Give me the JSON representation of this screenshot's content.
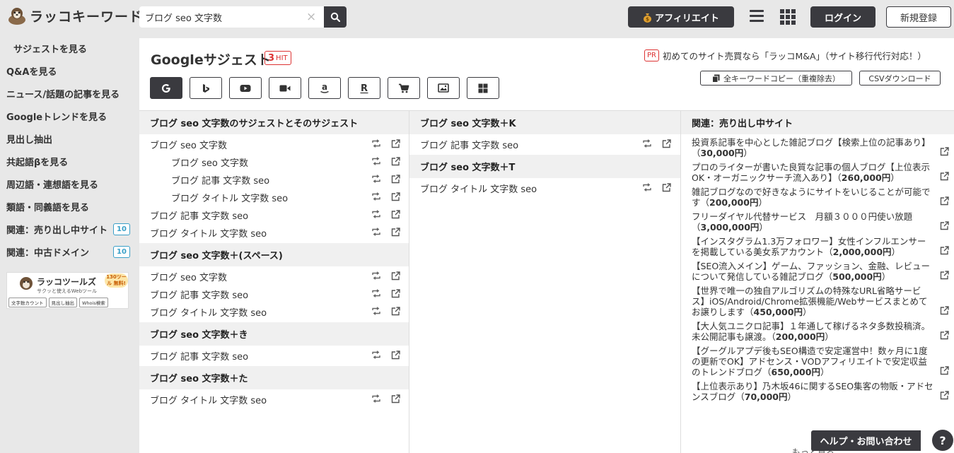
{
  "header": {
    "logo_text": "ラッコキーワード",
    "search_value": "ブログ seo 文字数",
    "affiliate_label": "アフィリエイト",
    "login_label": "ログイン",
    "register_label": "新規登録"
  },
  "sidebar": {
    "items": [
      {
        "label": "サジェストを見る",
        "badge": ""
      },
      {
        "label": "Q&Aを見る",
        "badge": ""
      },
      {
        "label": "ニュース/話題の記事を見る",
        "badge": ""
      },
      {
        "label": "Googleトレンドを見る",
        "badge": ""
      },
      {
        "label": "見出し抽出",
        "badge": ""
      },
      {
        "label": "共起語βを見る",
        "badge": ""
      },
      {
        "label": "周辺語・連想語を見る",
        "badge": ""
      },
      {
        "label": "類語・同義語を見る",
        "badge": ""
      },
      {
        "label": "関連：売り出し中サイト",
        "badge": "10"
      },
      {
        "label": "関連：中古ドメイン",
        "badge": "10"
      }
    ],
    "banner": {
      "title": "ラッコツールズ",
      "subtitle": "サクッと使えるWebツール",
      "tag": "130ツール 無料!",
      "buttons": [
        "文字数カウント",
        "見出し抽出",
        "Whois検索"
      ]
    }
  },
  "main": {
    "title": "Googleサジェスト",
    "hit_count": "3",
    "hit_label": "HIT",
    "pr_badge": "PR",
    "pr_text": "初めてのサイト売買なら「ラッコM&A」（サイト移行代行対応！）",
    "copy_all_label": "全キーワードコピー（重複除去）",
    "csv_label": "CSVダウンロード",
    "engines": [
      "google",
      "bing",
      "youtube",
      "video",
      "amazon",
      "rakuten",
      "shopping",
      "image",
      "apps"
    ]
  },
  "columns": {
    "col1": {
      "sections": [
        {
          "heading": "ブログ seo 文字数のサジェストとそのサジェスト",
          "rows": [
            {
              "text": "ブログ seo 文字数",
              "indent": false
            },
            {
              "text": "ブログ seo 文字数",
              "indent": true
            },
            {
              "text": "ブログ 記事 文字数 seo",
              "indent": true
            },
            {
              "text": "ブログ タイトル 文字数 seo",
              "indent": true
            },
            {
              "text": "ブログ 記事 文字数 seo",
              "indent": false
            },
            {
              "text": "ブログ タイトル 文字数 seo",
              "indent": false
            }
          ]
        },
        {
          "heading": "ブログ seo 文字数＋(スペース)",
          "rows": [
            {
              "text": "ブログ seo 文字数",
              "indent": false
            },
            {
              "text": "ブログ 記事 文字数 seo",
              "indent": false
            },
            {
              "text": "ブログ タイトル 文字数 seo",
              "indent": false
            }
          ]
        },
        {
          "heading": "ブログ seo 文字数＋き",
          "rows": [
            {
              "text": "ブログ 記事 文字数 seo",
              "indent": false
            }
          ]
        },
        {
          "heading": "ブログ seo 文字数＋た",
          "rows": [
            {
              "text": "ブログ タイトル 文字数 seo",
              "indent": false
            }
          ]
        }
      ]
    },
    "col2": {
      "sections": [
        {
          "heading": "ブログ seo 文字数＋K",
          "rows": [
            {
              "text": "ブログ 記事 文字数 seo",
              "indent": false
            }
          ]
        },
        {
          "heading": "ブログ seo 文字数＋T",
          "rows": [
            {
              "text": "ブログ タイトル 文字数 seo",
              "indent": false
            }
          ]
        }
      ]
    },
    "col3": {
      "heading": "関連：売り出し中サイト",
      "sites": [
        {
          "lines": [
            "投資系記事を中心とした雑記ブログ【検索上位の記事あり】",
            "（"
          ],
          "price": "30,000円",
          "suffix": "）"
        },
        {
          "lines": [
            "プロのライターが書いた良質な記事の個人ブログ【上位表示",
            "OK・オーガニックサーチ流入あり】（"
          ],
          "price": "260,000円",
          "suffix": "）"
        },
        {
          "lines": [
            "雑記ブログなので好きなようにサイトをいじることが可能で",
            "す（"
          ],
          "price": "200,000円",
          "suffix": "）"
        },
        {
          "lines": [
            "フリーダイヤル代替サービス　月額３０００円使い放題（",
            ""
          ],
          "price": "3,000,000円",
          "suffix": "）"
        },
        {
          "lines": [
            "【インスタグラム1.3万フォロワー】女性インフルエンサー",
            "を掲載している美女系アカウント（"
          ],
          "price": "2,000,000円",
          "suffix": "）"
        },
        {
          "lines": [
            "【SEO流入メイン】ゲーム、ファッション、金融、レビュー",
            "について発信している雑記ブログ（"
          ],
          "price": "500,000円",
          "suffix": "）"
        },
        {
          "lines": [
            "【世界で唯一の独自アルゴリズムの特殊なURL省略サービ",
            "ス】iOS/Android/Chrome拡張機能/Webサービスまとめて",
            "お譲りします（"
          ],
          "price": "450,000円",
          "suffix": "）"
        },
        {
          "lines": [
            "【大人気ユニクロ記事】１年通して稼げるネタ多数投稿済。",
            "未公開記事も譲渡。（"
          ],
          "price": "200,000円",
          "suffix": "）"
        },
        {
          "lines": [
            "【グーグルアプデ後もSEO構造で安定運営中！数ヶ月に1度",
            "の更新でOK】アドセンス・VODアフィリエイトで安定収益",
            "のトレンドブログ（"
          ],
          "price": "650,000円",
          "suffix": "）"
        },
        {
          "lines": [
            "【上位表示あり】乃木坂46に関するSEO集客の物販・アドセ",
            "ンスブログ（"
          ],
          "price": "70,000円",
          "suffix": "）"
        }
      ],
      "more_label": "もっと見る"
    }
  },
  "help": {
    "label": "ヘルプ・お問い合わせ",
    "q": "?"
  }
}
